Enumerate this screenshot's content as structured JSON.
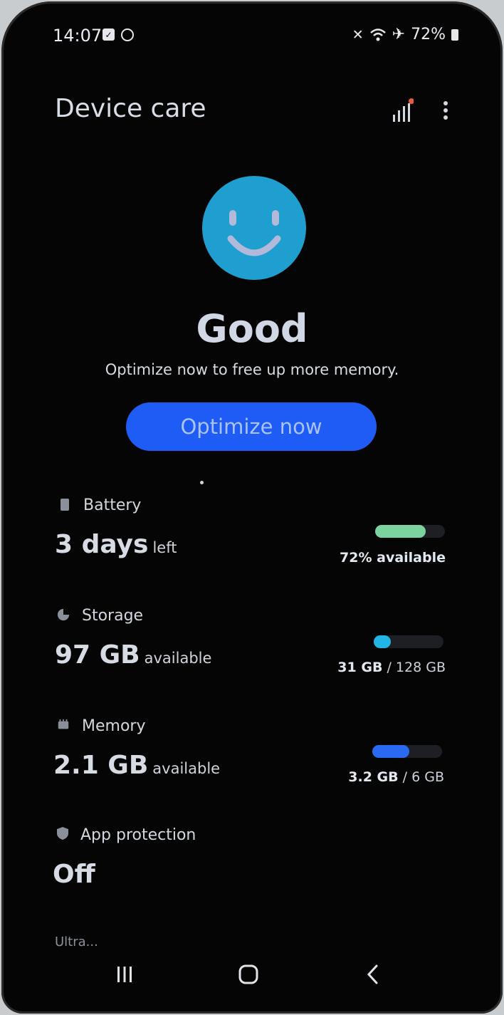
{
  "status_bar": {
    "time": "14:07",
    "battery_percent": "72%",
    "left_icons": [
      "calendar-check-icon",
      "app-notification-icon"
    ],
    "right_icons": [
      "mute-icon",
      "wifi-icon",
      "airplane-icon",
      "battery-icon"
    ]
  },
  "header": {
    "title": "Device care"
  },
  "summary": {
    "status": "Good",
    "message": "Optimize now to free up more memory.",
    "optimize_button": "Optimize now",
    "face_color": "#1e9fcf"
  },
  "cards": {
    "battery": {
      "label": "Battery",
      "value": "3 days",
      "suffix": "left",
      "caption_value": "72% available",
      "fill_fraction": 0.72,
      "bar_color": "#7bd4a0"
    },
    "storage": {
      "label": "Storage",
      "value": "97 GB",
      "suffix": "available",
      "used": "31 GB",
      "total": "/ 128 GB",
      "fill_fraction": 0.24,
      "bar_color": "#22b6e6"
    },
    "memory": {
      "label": "Memory",
      "value": "2.1 GB",
      "suffix": "available",
      "used": "3.2 GB",
      "total": "/ 6 GB",
      "fill_fraction": 0.53,
      "bar_color": "#2a6af3"
    },
    "app_protection": {
      "label": "App protection",
      "value": "Off"
    }
  },
  "partial_row": {
    "label": "Ultra..."
  },
  "navbar": {
    "recents": "recents-icon",
    "home": "home-icon",
    "back": "back-icon"
  }
}
